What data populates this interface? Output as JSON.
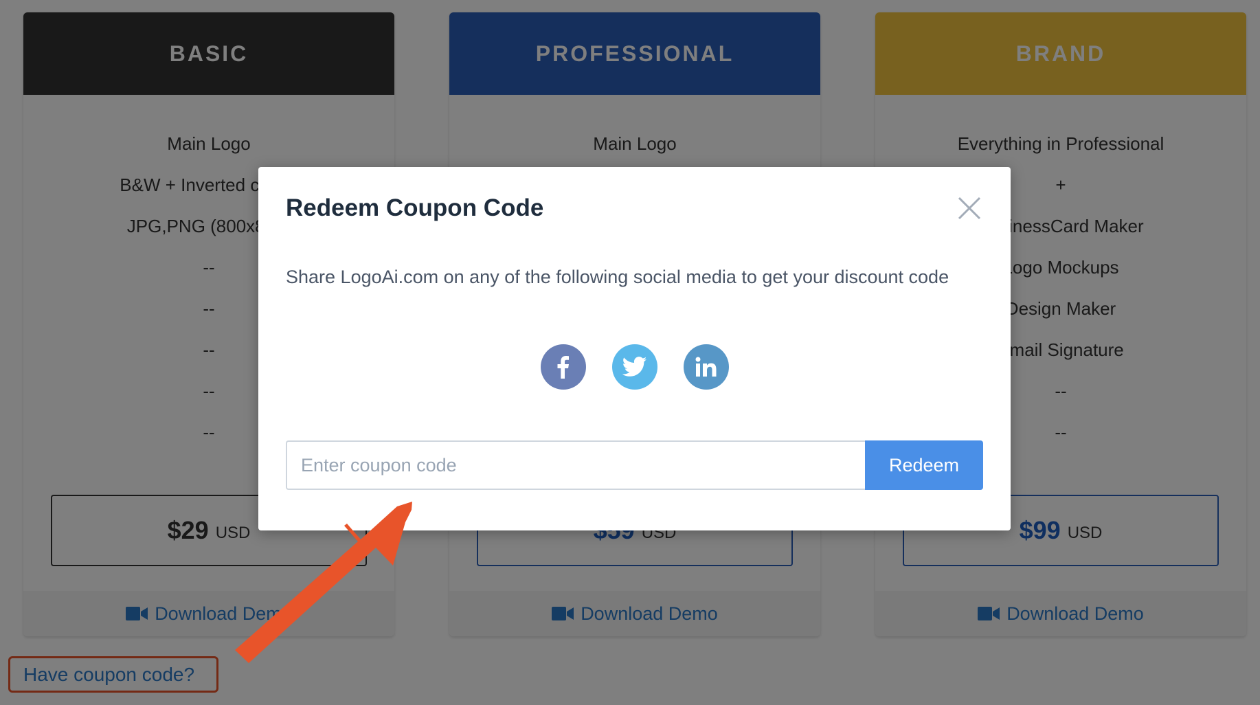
{
  "plans": [
    {
      "name": "BASIC",
      "header_color": "#333333",
      "features": [
        "Main Logo",
        "B&W + Inverted colors",
        "JPG,PNG (800x800)",
        "--",
        "--",
        "--",
        "--",
        "--"
      ],
      "price": "$29",
      "price_color": "#333333",
      "border_color": "#333333",
      "currency": "USD",
      "demo_label": "Download Demo"
    },
    {
      "name": "PROFESSIONAL",
      "header_color": "#2b5eb8",
      "features": [
        "Main Logo",
        "",
        "",
        "",
        "",
        "",
        "",
        ""
      ],
      "price": "$59",
      "price_color": "#1f5ec0",
      "border_color": "#2b5eb8",
      "currency": "USD",
      "demo_label": "Download Demo"
    },
    {
      "name": "BRAND",
      "header_color": "#f0c23e",
      "features": [
        "Everything in Professional",
        "+",
        "BusinessCard Maker",
        "Logo Mockups",
        "Design Maker",
        "Email Signature",
        "--",
        "--"
      ],
      "price": "$99",
      "price_color": "#1f5ec0",
      "border_color": "#2b5eb8",
      "currency": "USD",
      "demo_label": "Download Demo"
    }
  ],
  "coupon_link": "Have coupon code?",
  "modal": {
    "title": "Redeem Coupon Code",
    "description": "Share LogoAi.com on any of the following social media to get your discount code",
    "input_placeholder": "Enter coupon code",
    "redeem_label": "Redeem",
    "social": [
      {
        "name": "facebook",
        "label": "f",
        "color": "#6a7fb5"
      },
      {
        "name": "twitter",
        "label": "",
        "color": "#5ab8ea"
      },
      {
        "name": "linkedin",
        "label": "in",
        "color": "#5797c7"
      }
    ]
  },
  "colors": {
    "link": "#2b78c6",
    "annotation": "#e8542a",
    "redeem_button": "#4a8fe7"
  }
}
